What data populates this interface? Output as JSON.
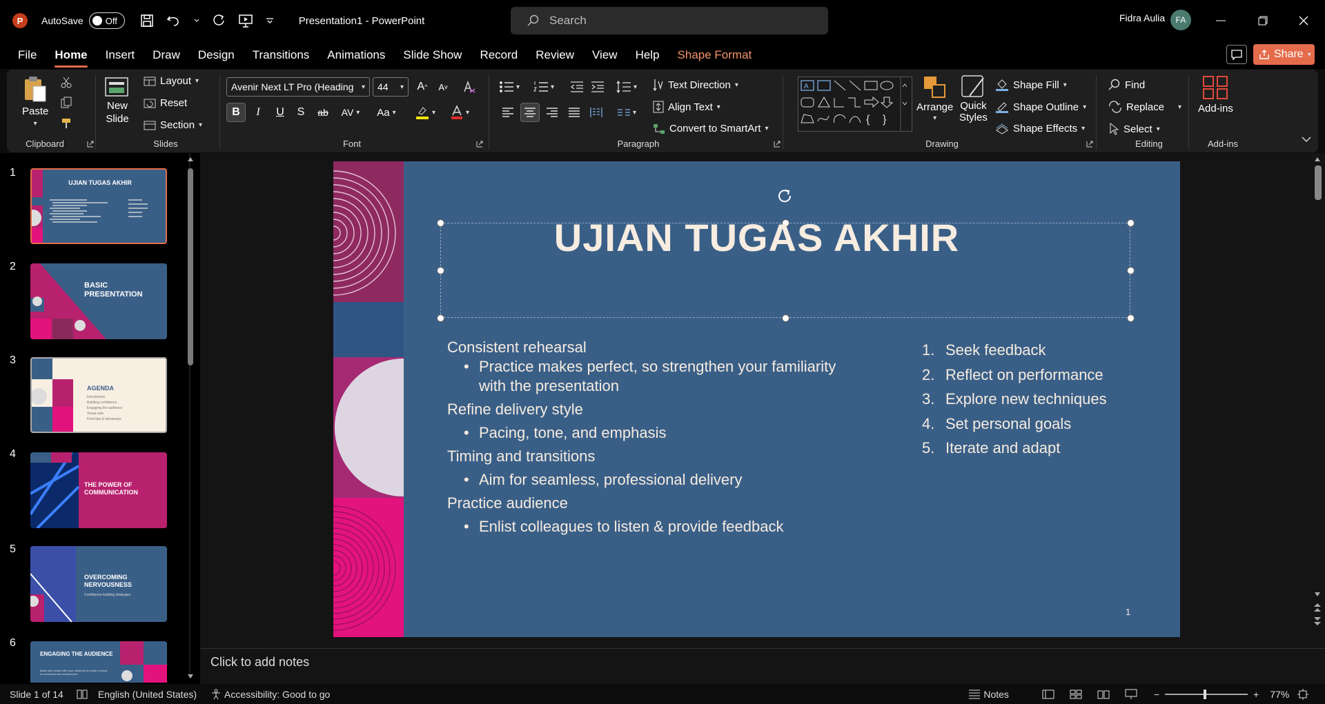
{
  "app": {
    "logo_letter": "P",
    "autosave_label": "AutoSave",
    "autosave_state": "Off",
    "document_title": "Presentation1  -  PowerPoint",
    "search_placeholder": "Search",
    "user_name": "Fidra Aulia",
    "user_initials": "FA"
  },
  "menu": {
    "tabs": [
      "File",
      "Home",
      "Insert",
      "Draw",
      "Design",
      "Transitions",
      "Animations",
      "Slide Show",
      "Record",
      "Review",
      "View",
      "Help",
      "Shape Format"
    ],
    "active_tab": "Home",
    "share_label": "Share"
  },
  "ribbon": {
    "clipboard": {
      "paste": "Paste",
      "label": "Clipboard"
    },
    "slides": {
      "new_slide_line1": "New",
      "new_slide_line2": "Slide",
      "layout": "Layout",
      "reset": "Reset",
      "section": "Section",
      "label": "Slides"
    },
    "font": {
      "family": "Avenir Next LT Pro (Heading",
      "size": "44",
      "label": "Font",
      "bold": "B",
      "italic": "I",
      "underline": "U",
      "shadow": "S",
      "strike": "ab",
      "spacing": "AV",
      "case": "Aa",
      "grow": "A",
      "shrink": "A",
      "highlight_color": "#f2e50b",
      "font_color": "#e02b2b"
    },
    "paragraph": {
      "text_direction": "Text Direction",
      "align_text": "Align Text",
      "smartart": "Convert to SmartArt",
      "label": "Paragraph"
    },
    "drawing": {
      "arrange": "Arrange",
      "quick_styles_line1": "Quick",
      "quick_styles_line2": "Styles",
      "shape_fill": "Shape Fill",
      "shape_outline": "Shape Outline",
      "shape_effects": "Shape Effects",
      "label": "Drawing"
    },
    "editing": {
      "find": "Find",
      "replace": "Replace",
      "select": "Select",
      "label": "Editing"
    },
    "addins": {
      "button": "Add-ins",
      "label": "Add-ins"
    }
  },
  "thumbnails": [
    {
      "num": "1",
      "title": "UJIAN TUGAS AKHIR",
      "selected": true
    },
    {
      "num": "2",
      "title": "BASIC PRESENTATION",
      "selected": false
    },
    {
      "num": "3",
      "title": "AGENDA",
      "selected": false,
      "items": [
        "Introduction",
        "Building confidence",
        "Engaging the audience",
        "Visual aids",
        "Final tips & takeaways"
      ]
    },
    {
      "num": "4",
      "title": "THE POWER OF COMMUNICATION",
      "selected": false
    },
    {
      "num": "5",
      "title": "OVERCOMING NERVOUSNESS",
      "subtitle": "Confidence-building strategies",
      "selected": false
    },
    {
      "num": "6",
      "title": "ENGAGING THE AUDIENCE",
      "subtitle": "Make eye contact with your audience to create a sense of connection and involvement",
      "selected": false
    }
  ],
  "slide": {
    "title": "UJIAN TUGAS AKHIR",
    "left_items": [
      {
        "heading": "Consistent rehearsal",
        "bullet": "Practice makes perfect, so strengthen your familiarity",
        "bullet_cont": "with the presentation"
      },
      {
        "heading": "Refine delivery style",
        "bullet": "Pacing, tone, and emphasis"
      },
      {
        "heading": "Timing and transitions",
        "bullet": "Aim for seamless, professional delivery"
      },
      {
        "heading": "Practice audience",
        "bullet": "Enlist colleagues to listen & provide feedback"
      }
    ],
    "right_items": [
      {
        "n": "1.",
        "text": "Seek feedback"
      },
      {
        "n": "2.",
        "text": "Reflect on performance"
      },
      {
        "n": "3.",
        "text": "Explore new techniques"
      },
      {
        "n": "4.",
        "text": "Set personal goals"
      },
      {
        "n": "5.",
        "text": "Iterate and adapt"
      }
    ],
    "page_number": "1",
    "background_color": "#3a5f87",
    "accent_magenta": "#c3186b",
    "accent_pink": "#e3137d"
  },
  "notes_placeholder": "Click to add notes",
  "status": {
    "slide_info": "Slide 1 of 14",
    "language": "English (United States)",
    "accessibility": "Accessibility: Good to go",
    "notes_label": "Notes",
    "zoom": "77%"
  }
}
